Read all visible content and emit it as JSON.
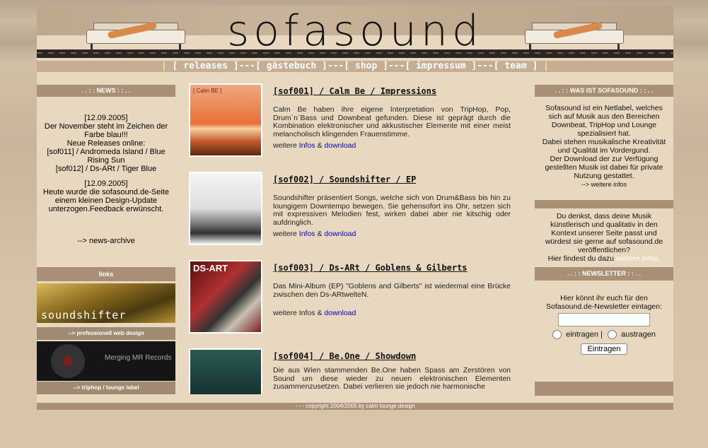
{
  "header": {
    "logo_text": "sofasound"
  },
  "nav": {
    "sep": "|",
    "dash": "]---[",
    "items": [
      "releases",
      "gästebuch",
      "shop",
      "impressum",
      "team"
    ]
  },
  "news": {
    "heading": ". . : : NEWS : : . .",
    "entry1": {
      "date": "[12.09.2005]",
      "line1": "Der November steht im Zeichen der",
      "line2": "Farbe blau!!!",
      "line3": "Neue Releases online:",
      "line4": "[sof011] / Andromeda Island / Blue",
      "line5": "Rising Sun",
      "line6": "[sof012] / Ds-ARt / Tiger Blue"
    },
    "entry2": {
      "date": "[12.09.2005]",
      "line1": "Heute wurde die sofasound.de-Seite",
      "line2": "einem kleinen Design-Update",
      "line3": "unterzogen.Feedback erwünscht."
    },
    "archive": "--> news-archive"
  },
  "links": {
    "heading": "links",
    "banner1_text": "soundshifter",
    "caption1": "--> professionell web design",
    "banner2_text": "Merging MR Records",
    "caption2": "--> triphop / lounge label"
  },
  "releases": [
    {
      "title": "[sof001] / Calm Be / Impressions",
      "thumb_label": "[ Calm BE ]",
      "text": "Calm Be haben ihre eigene Interpretation von TripHop, Pop, Drum`n`Bass und Downbeat gefunden. Diese ist geprägt durch die Kombination elektronischer und akkustischer Elemente mit einer meist melancholisch klingenden Frauenstimme.",
      "more": "weitere",
      "infos": "Infos",
      "amp": "&",
      "download": "download"
    },
    {
      "title": "[sof002] / Soundshifter / EP",
      "thumb_label": "",
      "text": "Soundshifter präsentiert Songs, welche sich von Drum&Bass bis hin zu loungigem Downtempo bewegen. Sie gehensofort ins Ohr, setzen sich mit expressiven Melodien fest, wirken dabei aber nie kitschig oder aufdringlich.",
      "more": "weitere",
      "infos": "Infos",
      "amp": "&",
      "download": "download"
    },
    {
      "title": "[sof003] / Ds-ARt / Goblens & Gilberts",
      "thumb_label": "DS-ART",
      "text": "Das Mini-Album (EP) \"Goblens and Gilberts\" ist wiedermal eine Brücke zwischen den Ds-ARtwelteN.",
      "more": "weitere Infos",
      "infos": "",
      "amp": "&",
      "download": "download"
    },
    {
      "title": "[sof004] / Be.One / Showdown",
      "thumb_label": "",
      "text": "Die aus Wien stammenden Be.One haben Spass am Zerstören von Sound um diese wieder zu neuen elektronischen Elementen zusammenzusetzen. Dabei verlieren sie jedoch nie harmonische",
      "more": "",
      "infos": "",
      "amp": "",
      "download": ""
    }
  ],
  "about": {
    "heading": ". . : : WAS IST SOFASOUND : : . .",
    "l1": "Sofasound ist ein Netlabel, welches",
    "l2": "sich auf Musik aus den Bereichen",
    "l3": "Downbeat, TripHop und Lounge",
    "l4": "spezialisiert hat.",
    "l5": "Dabei stehen musikalische Kreativität",
    "l6": "und Qualität im Vordergund.",
    "l7": "Der Download der zur Verfügung",
    "l8": "gestellten Musik ist dabei für private",
    "l9": "Nutzung gestattet.",
    "more": "--> weitere infos"
  },
  "submit": {
    "l1": "Du denkst, dass deine Musik",
    "l2": "künstlerisch und qualitativ in den",
    "l3": "Kontext unserer Seite passt und",
    "l4": "würdest sie gerne auf sofasound.de",
    "l5": "veröffentlichen?",
    "l6": "Hier findest du dazu",
    "link": "weitere Infos."
  },
  "newsletter": {
    "heading": ". . : : NEWSLETTER : : . .",
    "l1": "Hier könnt ihr euch für den",
    "l2": "Sofasound.de-Newsletter eintagen:",
    "email_value": "",
    "opt1": "eintragen",
    "sep": "|",
    "opt2": "austragen",
    "button": "Eintragen"
  },
  "footer": {
    "text": "- - - copyright 2004/2005 by calm lounge design"
  }
}
